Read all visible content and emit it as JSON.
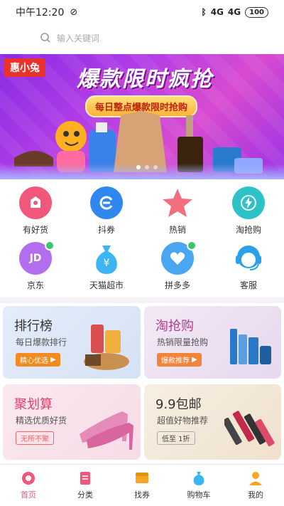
{
  "status": {
    "time": "中午12:20",
    "signal1": "4G",
    "signal2": "4G",
    "battery": "100"
  },
  "search": {
    "placeholder": "输入关键词"
  },
  "banner": {
    "brand": "惠小兔",
    "title": "爆款限时疯抢",
    "subtitle": "每日整点爆款限时抢购"
  },
  "grid": [
    {
      "label": "有好货",
      "icon": "gift-icon",
      "color": "#f0577a"
    },
    {
      "label": "抖券",
      "icon": "coupon-icon",
      "color": "#2f87f0"
    },
    {
      "label": "热销",
      "icon": "star-icon",
      "color": "#f26e7c"
    },
    {
      "label": "淘抢购",
      "icon": "lightning-icon",
      "color": "#2cc2c8"
    },
    {
      "label": "京东",
      "icon": "jd-icon",
      "color": "#b36ef0"
    },
    {
      "label": "天猫超市",
      "icon": "money-bag-icon",
      "color": "#3cb5f2"
    },
    {
      "label": "拼多多",
      "icon": "heart-icon",
      "color": "#4aa6f0"
    },
    {
      "label": "客服",
      "icon": "headset-icon",
      "color": "#2aa0e6"
    }
  ],
  "cards": {
    "ranking": {
      "title": "排行榜",
      "sub": "每日爆款排行",
      "btn": "精心优选"
    },
    "flash": {
      "title": "淘抢购",
      "sub": "热销限量抢购",
      "btn": "爆款推荐"
    },
    "juhuasuan": {
      "title": "聚划算",
      "sub": "精选优质好货",
      "btn": "无所不聚"
    },
    "nine": {
      "title": "9.9包邮",
      "sub": "超值好物推荐",
      "btn": "低至  1折"
    }
  },
  "tabs": [
    {
      "label": "首页",
      "icon": "home-icon"
    },
    {
      "label": "分类",
      "icon": "category-icon"
    },
    {
      "label": "找券",
      "icon": "find-coupon-icon"
    },
    {
      "label": "购物车",
      "icon": "cart-icon"
    },
    {
      "label": "我的",
      "icon": "user-icon"
    }
  ]
}
